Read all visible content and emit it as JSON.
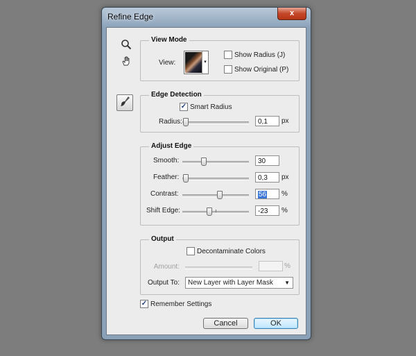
{
  "dialog": {
    "title": "Refine Edge",
    "close_glyph": "x"
  },
  "tools": {
    "zoom_icon": "zoom-icon",
    "hand_icon": "hand-icon",
    "brush_icon": "refine-radius-icon"
  },
  "view_mode": {
    "title": "View Mode",
    "view_label": "View:",
    "dropdown_arrow": "▾",
    "show_radius": {
      "label": "Show Radius (J)",
      "checked": false
    },
    "show_original": {
      "label": "Show Original (P)",
      "checked": false
    }
  },
  "edge_detection": {
    "title": "Edge Detection",
    "smart_radius": {
      "label": "Smart Radius",
      "checked": true
    },
    "radius": {
      "label": "Radius:",
      "value": "0,1",
      "unit": "px",
      "slider_fraction": 0.0
    }
  },
  "adjust_edge": {
    "title": "Adjust Edge",
    "smooth": {
      "label": "Smooth:",
      "value": "30",
      "unit": "",
      "slider_fraction": 0.3
    },
    "feather": {
      "label": "Feather:",
      "value": "0,3",
      "unit": "px",
      "slider_fraction": 0.0
    },
    "contrast": {
      "label": "Contrast:",
      "value": "56",
      "unit": "%",
      "slider_fraction": 0.56
    },
    "shift_edge": {
      "label": "Shift Edge:",
      "value": "-23",
      "unit": "%",
      "slider_fraction": 0.385
    }
  },
  "output": {
    "title": "Output",
    "decontaminate": {
      "label": "Decontaminate Colors",
      "checked": false
    },
    "amount": {
      "label": "Amount:",
      "value": "",
      "unit": "%"
    },
    "output_to": {
      "label": "Output To:",
      "value": "New Layer with Layer Mask",
      "arrow": "▼"
    }
  },
  "remember": {
    "label": "Remember Settings",
    "checked": true
  },
  "buttons": {
    "cancel": "Cancel",
    "ok": "OK"
  },
  "check_glyph": "✓"
}
